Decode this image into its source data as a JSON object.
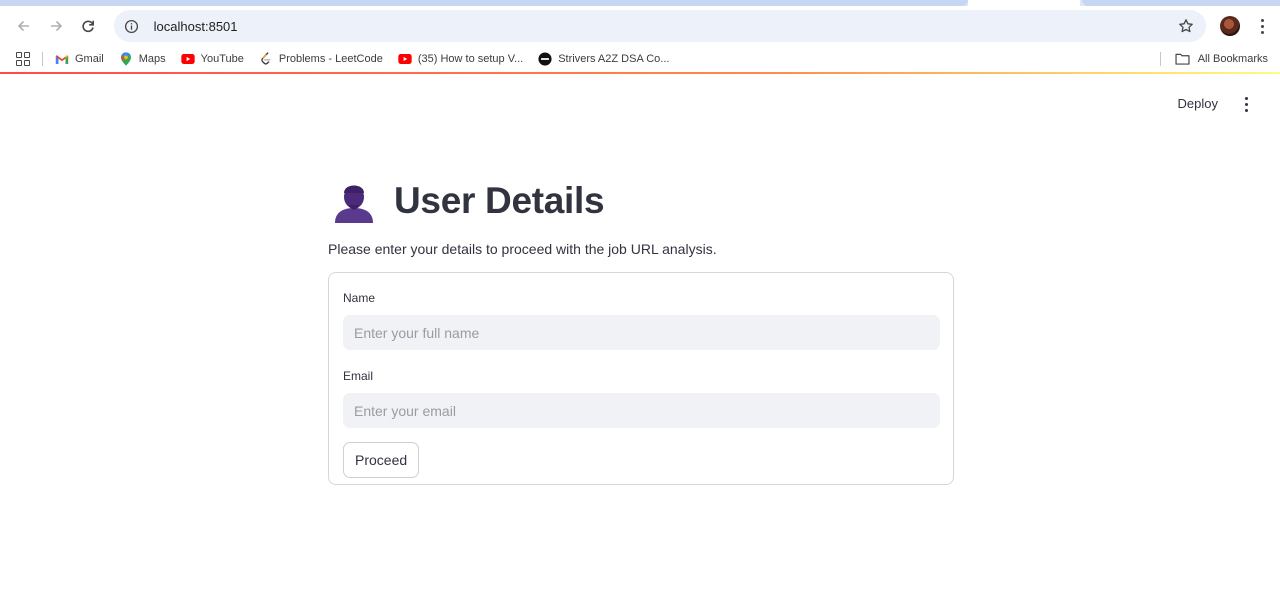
{
  "browser": {
    "url": "localhost:8501",
    "bookmarks": [
      {
        "label": "Gmail",
        "icon": "gmail-icon"
      },
      {
        "label": "Maps",
        "icon": "maps-icon"
      },
      {
        "label": "YouTube",
        "icon": "youtube-icon"
      },
      {
        "label": "Problems - LeetCode",
        "icon": "leetcode-icon"
      },
      {
        "label": "(35) How to setup V...",
        "icon": "youtube-icon"
      },
      {
        "label": "Strivers A2Z DSA Co...",
        "icon": "tuf-icon"
      }
    ],
    "all_bookmarks_label": "All Bookmarks"
  },
  "app": {
    "deploy_label": "Deploy",
    "title": "User Details",
    "title_icon": "bust-in-silhouette-icon",
    "subtitle": "Please enter your details to proceed with the job URL analysis.",
    "form": {
      "name_label": "Name",
      "name_placeholder": "Enter your full name",
      "name_value": "",
      "email_label": "Email",
      "email_placeholder": "Enter your email",
      "email_value": "",
      "submit_label": "Proceed"
    }
  },
  "colors": {
    "text": "#31333f",
    "input_bg": "#f0f2f6",
    "accent_start": "#ff4b4b",
    "accent_end": "#fffd80",
    "emoji": "#4b2a7a"
  }
}
